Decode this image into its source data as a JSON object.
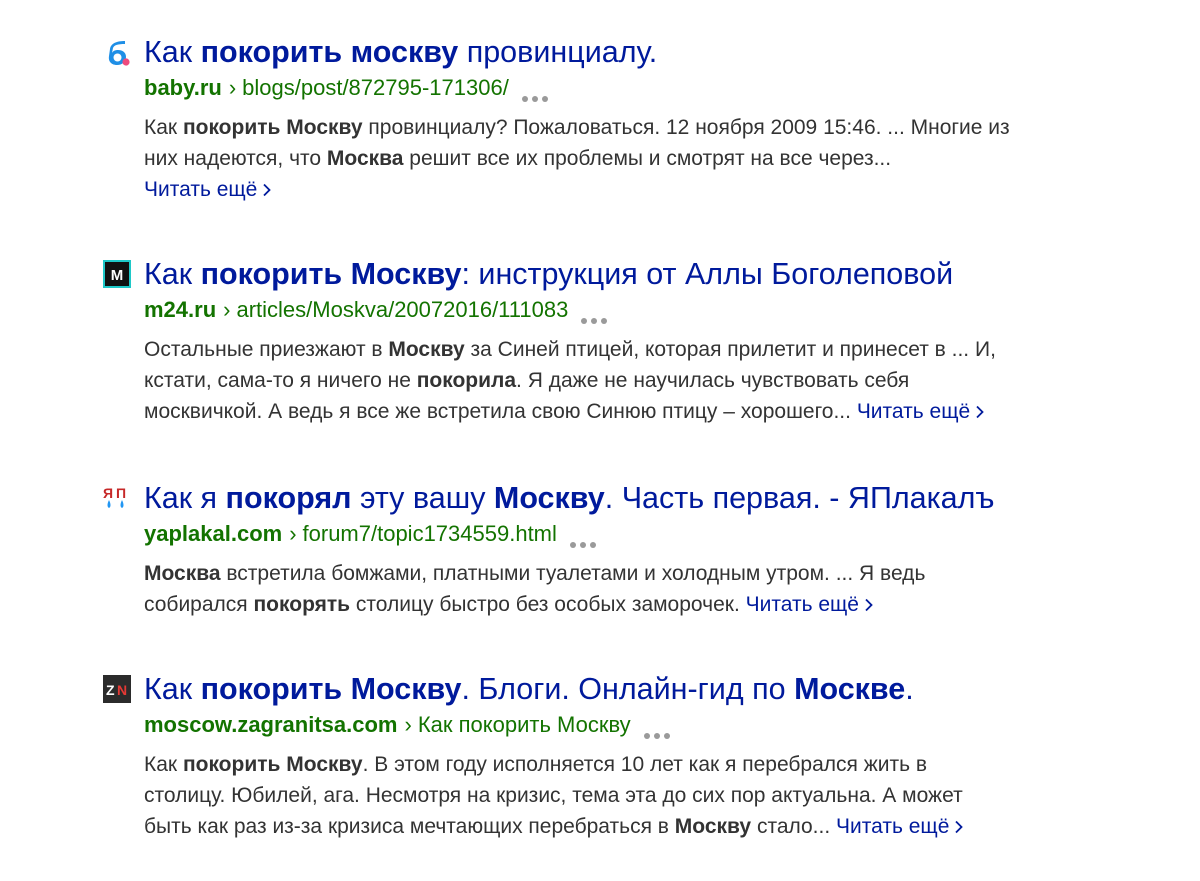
{
  "results": [
    {
      "favicon": "baby-ru-logo",
      "title_parts": [
        "Как ",
        "покорить москву",
        " провинциалу."
      ],
      "domain": "baby.ru",
      "sep": "›",
      "path": "blogs/post/872795-171306/",
      "snippet": [
        [
          "Как ",
          false
        ],
        [
          "покорить Москву",
          true
        ],
        [
          " провинциалу? Пожаловаться. 12 ноября 2009 15:46. ... Многие из ",
          false
        ],
        [
          "__br__",
          false
        ],
        [
          "них надеются, что ",
          false
        ],
        [
          "Москва",
          true
        ],
        [
          " решит все их проблемы и смотрят на все через...",
          false
        ],
        [
          "__br__",
          false
        ]
      ],
      "more": "Читать ещё"
    },
    {
      "favicon": "m24-logo",
      "title_parts": [
        "Как ",
        "покорить Москву",
        ": инструкция от Аллы Боголеповой"
      ],
      "domain": "m24.ru",
      "sep": "›",
      "path": "articles/Moskva/20072016/111083",
      "snippet": [
        [
          "Остальные приезжают в ",
          false
        ],
        [
          "Москву",
          true
        ],
        [
          " за Синей птицей, которая прилетит и принесет в ... И,",
          false
        ],
        [
          "__br__",
          false
        ],
        [
          "кстати, сама-то я ничего не ",
          false
        ],
        [
          "покорила",
          true
        ],
        [
          ". Я даже не научилась чувствовать себя",
          false
        ],
        [
          "__br__",
          false
        ],
        [
          "москвичкой. А ведь я все же встретила свою Синюю птицу – хорошего... ",
          false
        ]
      ],
      "more": "Читать ещё"
    },
    {
      "favicon": "yaplakal-logo",
      "title_parts": [
        "Как я ",
        "покорял",
        " эту вашу ",
        "Москву",
        ". Часть первая. - ЯПлакалъ"
      ],
      "domain": "yaplakal.com",
      "sep": "›",
      "path": "forum7/topic1734559.html",
      "snippet": [
        [
          "Москва",
          true
        ],
        [
          " встретила бомжами, платными туалетами и холодным утром. ... Я ведь",
          false
        ],
        [
          "__br__",
          false
        ],
        [
          "собирался ",
          false
        ],
        [
          "покорять",
          true
        ],
        [
          " столицу быстро без особых заморочек. ",
          false
        ]
      ],
      "more": "Читать ещё"
    },
    {
      "favicon": "zagranitsa-zn-logo",
      "title_parts": [
        "Как ",
        "покорить Москву",
        ". Блоги. Онлайн-гид по ",
        "Москве",
        "."
      ],
      "domain": "moscow.zagranitsa.com",
      "sep": "›",
      "path": "Как покорить Москву",
      "snippet": [
        [
          "Как ",
          false
        ],
        [
          "покорить Москву",
          true
        ],
        [
          ". В этом году исполняется 10 лет как я перебрался жить в",
          false
        ],
        [
          "__br__",
          false
        ],
        [
          "столицу. Юбилей, ага. Несмотря на кризис, тема эта до сих пор актуальна. А может",
          false
        ],
        [
          "__br__",
          false
        ],
        [
          "быть как раз из-за кризиса мечтающих перебраться в ",
          false
        ],
        [
          "Москву",
          true
        ],
        [
          " стало... ",
          false
        ]
      ],
      "more": "Читать ещё"
    }
  ],
  "colors": {
    "title": "#001a9c",
    "url": "#137300",
    "snippet": "#333333",
    "dots": "#9a9a9a"
  }
}
